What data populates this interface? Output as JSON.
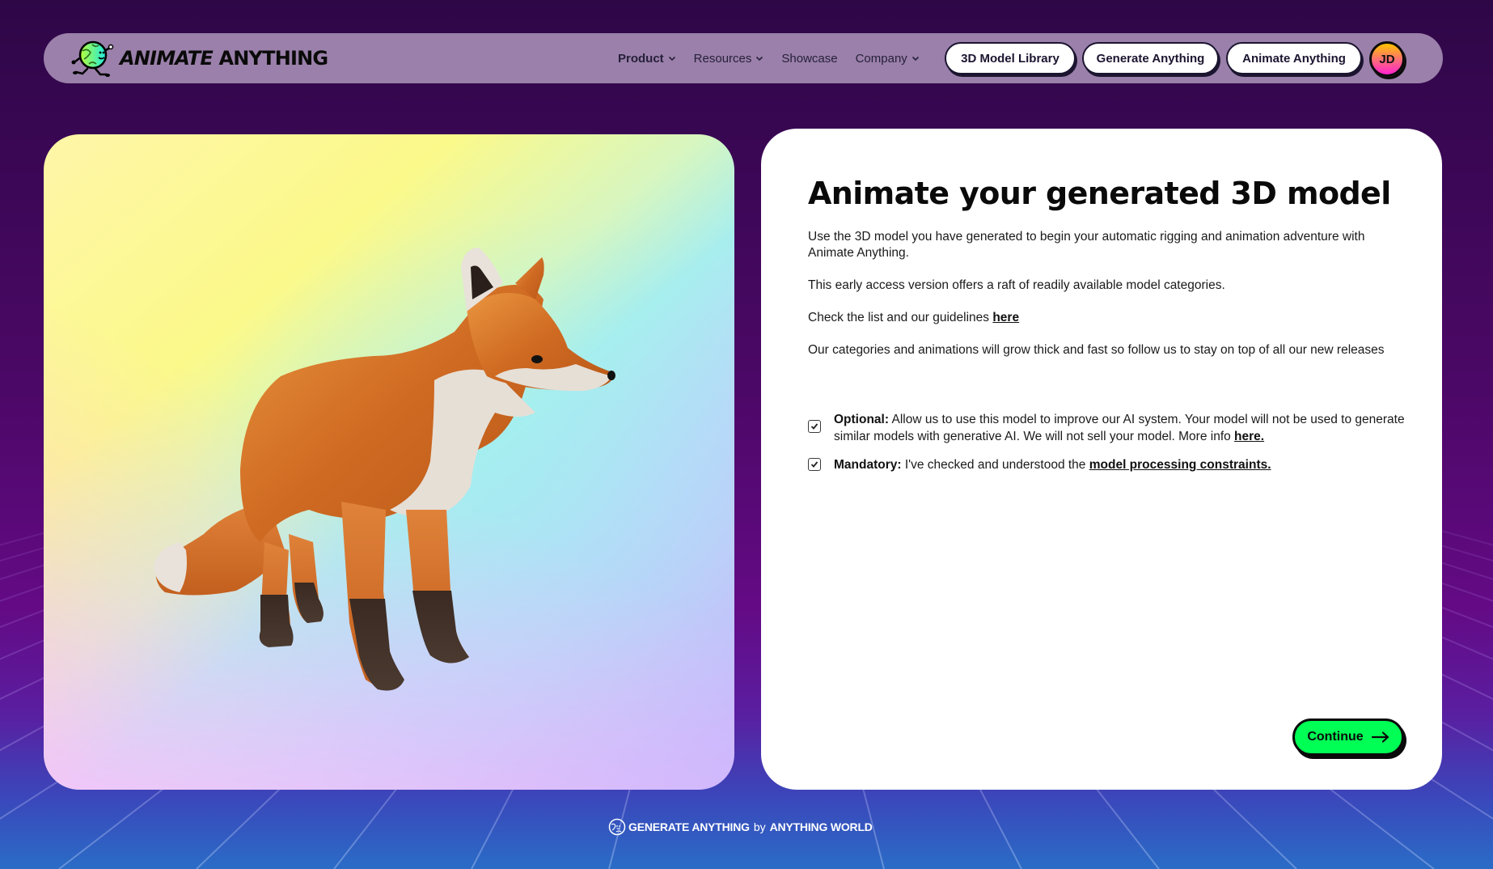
{
  "nav": {
    "logo": {
      "italic": "ANIMATE",
      "bold": "ANYTHING",
      "icon": "running-globe-icon"
    },
    "links": [
      {
        "label": "Product",
        "has_dropdown": true
      },
      {
        "label": "Resources",
        "has_dropdown": true
      },
      {
        "label": "Showcase",
        "has_dropdown": false
      },
      {
        "label": "Company",
        "has_dropdown": true
      }
    ],
    "buttons": [
      {
        "label": "3D Model Library"
      },
      {
        "label": "Generate Anything"
      },
      {
        "label": "Animate Anything"
      }
    ],
    "avatar_initials": "JD"
  },
  "preview": {
    "model": "3D low-poly fox model",
    "icon": "fox-model"
  },
  "card": {
    "title": "Animate your generated 3D model",
    "paragraphs": {
      "p1": "Use the 3D model you have generated to begin your automatic rigging and animation adventure with Animate Anything.",
      "p2": "This early access version offers a raft of readily available model categories.",
      "p3_text": "Check the list and our guidelines ",
      "p3_link": "here",
      "p4": "Our categories and animations will grow thick and fast so follow us to stay on top of all our new releases"
    },
    "consents": [
      {
        "label": "Optional:",
        "text": " Allow us to use this model to improve our AI system. Your model will not be used to generate similar models with generative AI. We will not sell your model. More info ",
        "link": "here.",
        "checked": true
      },
      {
        "label": "Mandatory:",
        "text": " I've checked and understood the ",
        "link": "model processing constraints.",
        "checked": true
      }
    ],
    "continue_label": "Continue"
  },
  "footer": {
    "brand": "GENERATE ANYTHING",
    "by": "by",
    "company": "ANYTHING WORLD"
  },
  "colors": {
    "accent_green": "#00ff55",
    "nav_bg": "#9a80aa",
    "bg_top": "#2e0747",
    "bg_bottom": "#2a6cc6"
  }
}
